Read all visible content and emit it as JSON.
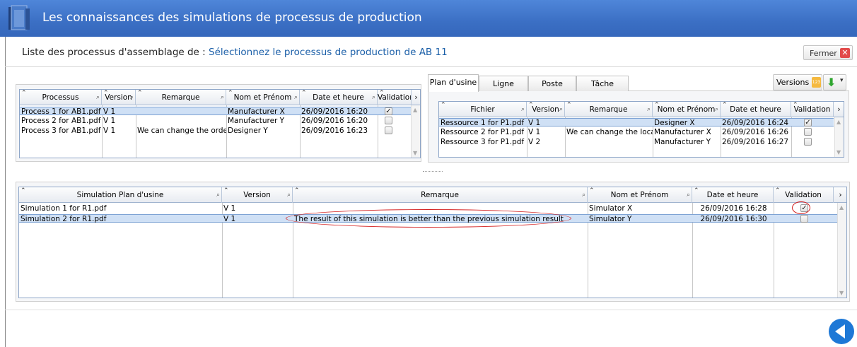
{
  "window": {
    "title": "Les connaissances des simulations de processus de production"
  },
  "header": {
    "subtitle_label": "Liste des processus d'assemblage de :",
    "subtitle_link": "Sélectionnez le processus de production de AB 11",
    "close_label": "Fermer"
  },
  "process_grid": {
    "columns": [
      "Processus",
      "Version",
      "Remarque",
      "Nom et Prénom",
      "Date et heure",
      "Validation"
    ],
    "rows": [
      {
        "process": "Process 1 for AB1.pdf",
        "version": "V 1",
        "remark": "",
        "name": "Manufacturer X",
        "date": "26/09/2016 16:20",
        "validated": true
      },
      {
        "process": "Process 2 for AB1.pdf",
        "version": "V 1",
        "remark": "",
        "name": "Manufacturer Y",
        "date": "26/09/2016 16:20",
        "validated": false
      },
      {
        "process": "Process 3 for AB1.pdf",
        "version": "V 1",
        "remark": "We can change the orde",
        "name": "Designer Y",
        "date": "26/09/2016 16:23",
        "validated": false
      }
    ],
    "selected_row": 0
  },
  "tabs": [
    "Plan d'usine",
    "Ligne",
    "Poste",
    "Tâche"
  ],
  "active_tab": 0,
  "versions_label": "Versions",
  "versions_badge": "123",
  "resource_grid": {
    "columns": [
      "Fichier",
      "Version",
      "Remarque",
      "Nom et Prénom",
      "Date et heure",
      "Validation"
    ],
    "rows": [
      {
        "file": "Ressource 1 for P1.pdf",
        "version": "V 1",
        "remark": "",
        "name": "Designer X",
        "date": "26/09/2016 16:24",
        "validated": true
      },
      {
        "file": "Ressource 2 for P1.pdf",
        "version": "V 1",
        "remark": "We can change the loca",
        "name": "Manufacturer X",
        "date": "26/09/2016 16:26",
        "validated": false
      },
      {
        "file": "Ressource 3 for P1.pdf",
        "version": "V 2",
        "remark": "",
        "name": "Manufacturer Y",
        "date": "26/09/2016 16:27",
        "validated": false
      }
    ],
    "selected_row": 0
  },
  "simulation_grid": {
    "columns": [
      "Simulation Plan d'usine",
      "Version",
      "Remarque",
      "Nom et Prénom",
      "Date et heure",
      "Validation"
    ],
    "rows": [
      {
        "sim": "Simulation 1 for R1.pdf",
        "version": "V 1",
        "remark": "",
        "name": "Simulator X",
        "date": "26/09/2016 16:28",
        "validated": true
      },
      {
        "sim": "Simulation 2 for R1.pdf",
        "version": "V 1",
        "remark": "The result of this simulation is better than the previous simulation result",
        "name": "Simulator Y",
        "date": "26/09/2016 16:30",
        "validated": false
      }
    ],
    "selected_row": 1
  },
  "colors": {
    "titlebar": "#3b6fc4",
    "selection": "#cfe0f5",
    "link": "#1b5fa8",
    "annotation": "#d42121",
    "back_button": "#1e78d6"
  }
}
